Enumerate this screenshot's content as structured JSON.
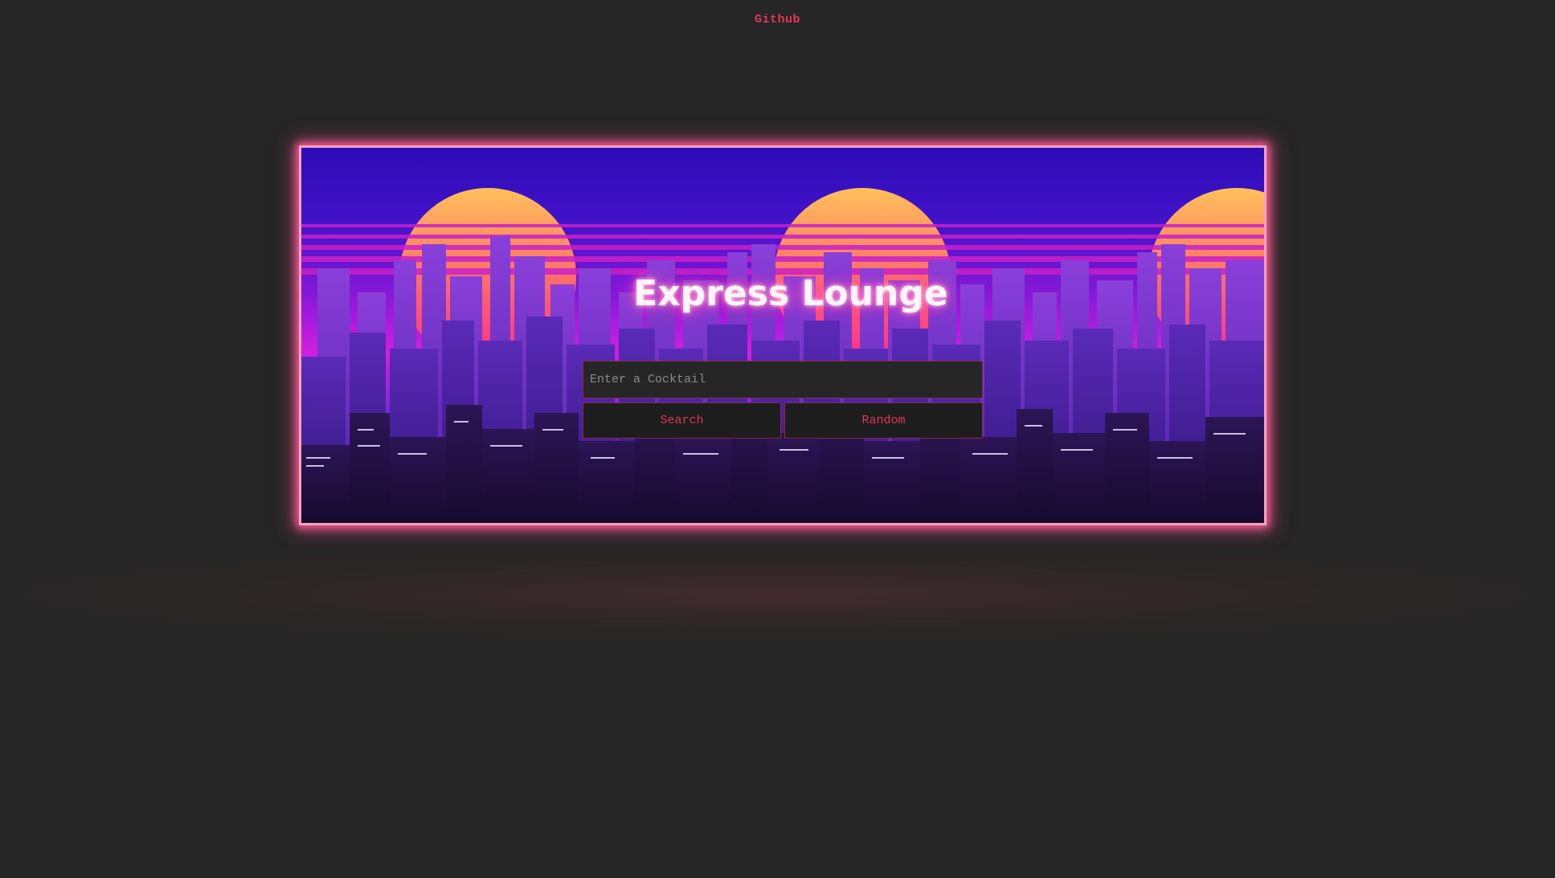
{
  "header": {
    "github_link": "Github"
  },
  "hero": {
    "title": "Express Lounge"
  },
  "search": {
    "placeholder": "Enter a Cocktail",
    "value": ""
  },
  "buttons": {
    "search_label": "Search",
    "random_label": "Random"
  },
  "colors": {
    "background": "#262626",
    "accent": "#e0375a",
    "frame_glow": "#ff5c9a"
  }
}
